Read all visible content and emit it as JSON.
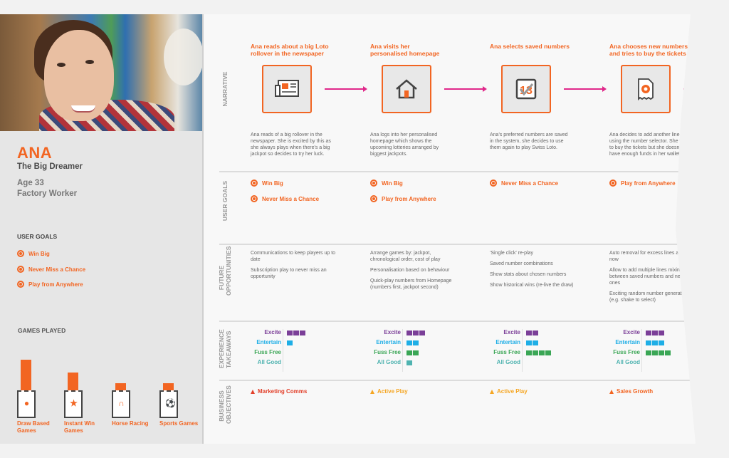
{
  "persona": {
    "name": "ANA",
    "tagline": "The Big Dreamer",
    "age": "Age 33",
    "occupation": "Factory Worker",
    "goals_heading": "USER GOALS",
    "goals": [
      "Win Big",
      "Never Miss a Chance",
      "Play from Anywhere"
    ],
    "games_heading": "GAMES PLAYED",
    "games": [
      {
        "label": "Draw Based Games",
        "icon": "lottery-ball-icon",
        "level": 1.0
      },
      {
        "label": "Instant Win Games",
        "icon": "star-icon",
        "level": 0.5
      },
      {
        "label": "Horse Racing",
        "icon": "horseshoe-icon",
        "level": 0.1
      },
      {
        "label": "Sports Games",
        "icon": "football-icon",
        "level": 0.1
      }
    ]
  },
  "rows": {
    "narrative": "NARRATIVE",
    "user_goals": "USER GOALS",
    "future_opportunities": "FUTURE OPPORTUNITIES",
    "experience_takeaways": "EXPERIENCE TAKEAWAYS",
    "business_objectives": "BUSINESS OBJECTIVES"
  },
  "takeaway_labels": [
    "Excite",
    "Entertain",
    "Fuss Free",
    "All Good"
  ],
  "takeaway_colors": [
    "#7b3f98",
    "#1eaee6",
    "#3aa655",
    "#4fb3b0"
  ],
  "objective_colors": {
    "marketing": "#e2402a",
    "active": "#f5a623",
    "sales": "#f26522"
  },
  "steps": [
    {
      "title": "Ana reads about a big Loto rollover in the newspaper",
      "icon": "newspaper-icon",
      "description": "Ana reads of a big rollover in the newspaper. She is excited by this as she always plays when there's a big jackpot so decides to try her luck.",
      "goals": [
        "Win Big",
        "Never Miss a Chance"
      ],
      "opportunities": [
        "Communications to keep players up to date",
        "Subscription play to never miss an opportunity"
      ],
      "takeaways": [
        3,
        1,
        0,
        0
      ],
      "objective": {
        "label": "Marketing Comms",
        "type": "marketing"
      }
    },
    {
      "title": "Ana visits her personalised homepage",
      "icon": "home-icon",
      "description": "Ana logs into her personalised homepage which shows the upcoming lotteries arranged by biggest jackpots.",
      "goals": [
        "Win Big",
        "Play from Anywhere"
      ],
      "opportunities": [
        "Arrange games by: jackpot, chronological order, cost of play",
        "Personalisation based on behaviour",
        "Quick-play numbers from Homepage (numbers first, jackpot second)"
      ],
      "takeaways": [
        3,
        2,
        2,
        1
      ],
      "objective": {
        "label": "Active Play",
        "type": "active"
      }
    },
    {
      "title": "Ana selects saved numbers",
      "icon": "saved-numbers-icon",
      "description": "Ana's preferred numbers are saved in the system, she decides to use them again to play Swiss Loto.",
      "goals": [
        "Never Miss a Chance"
      ],
      "opportunities": [
        "'Single click' re-play",
        "Saved number combinations",
        "Show stats about chosen numbers",
        "Show historical wins (re-live the draw)"
      ],
      "takeaways": [
        2,
        2,
        4,
        0
      ],
      "objective": {
        "label": "Active Play",
        "type": "active"
      }
    },
    {
      "title": "Ana chooses new numbers and tries to buy the tickets",
      "icon": "ticket-icon",
      "description": "Ana decides to add another line using the number selector. She tries to buy the tickets but she doesn't have enough funds in her wallet.",
      "goals": [
        "Play from Anywhere"
      ],
      "opportunities": [
        "Auto removal for excess lines and play now",
        "Allow to add multiple lines mixing between saved numbers and new ones",
        "Exciting random number generator (e.g. shake to select)"
      ],
      "takeaways": [
        3,
        3,
        4,
        0
      ],
      "objective": {
        "label": "Sales Growth",
        "type": "sales"
      }
    }
  ]
}
